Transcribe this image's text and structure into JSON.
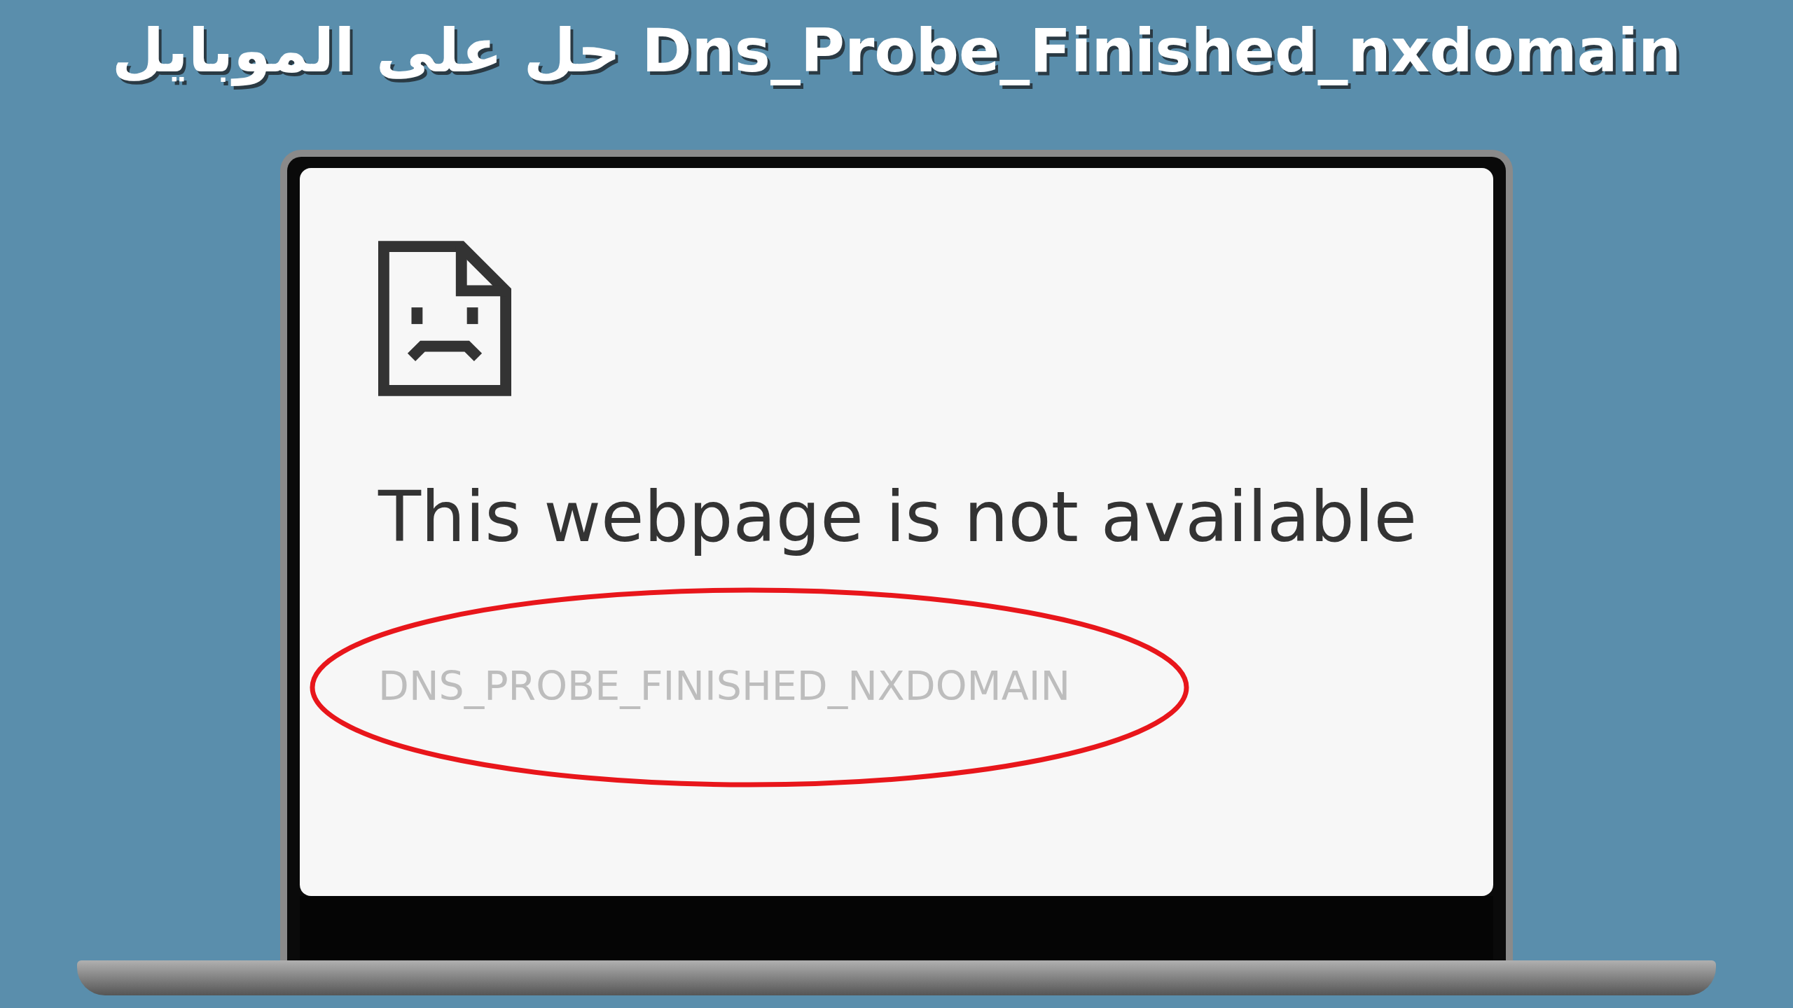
{
  "headline": "Dns_Probe_Finished_nxdomain حل على الموبايل",
  "error_page": {
    "title": "This webpage is not available",
    "error_code": "DNS_PROBE_FINISHED_NXDOMAIN"
  }
}
